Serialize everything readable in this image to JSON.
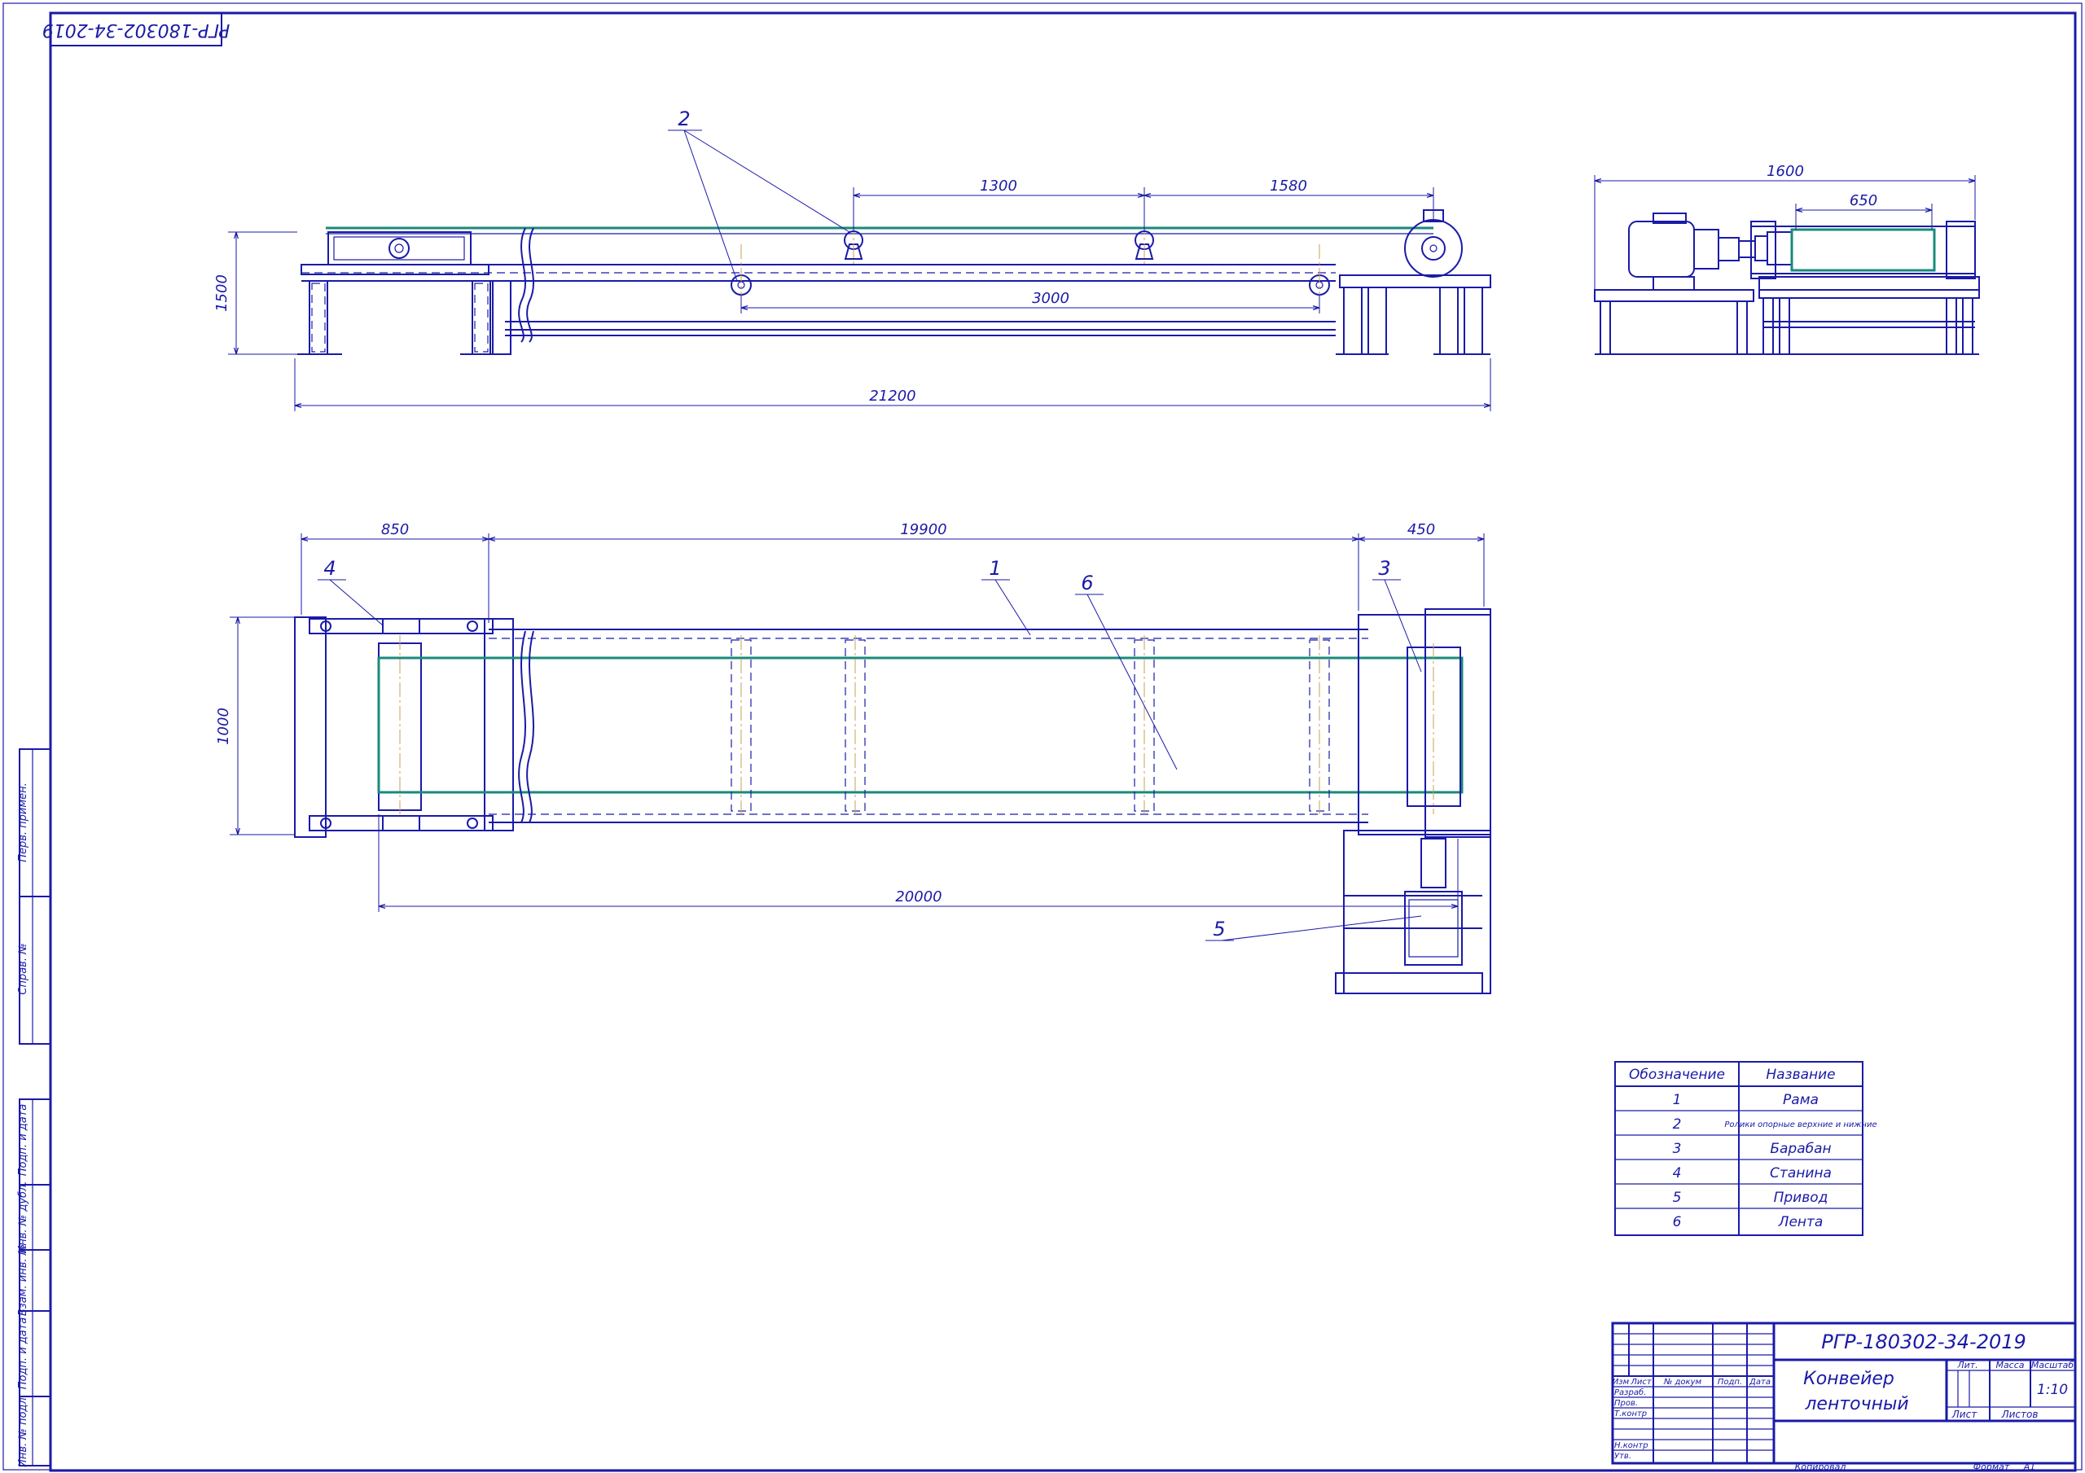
{
  "stamp": {
    "designation_rotated": "РГР-180302-34-2019"
  },
  "side_view": {
    "dimensions": {
      "d1300": "1300",
      "d1580": "1580",
      "d3000": "3000",
      "d21200": "21200",
      "d1500": "1500"
    },
    "callouts": {
      "c2": "2"
    }
  },
  "end_view": {
    "dimensions": {
      "d1600": "1600",
      "d650": "650"
    }
  },
  "plan_view": {
    "dimensions": {
      "d850": "850",
      "d19900": "19900",
      "d450": "450",
      "d1000": "1000",
      "d20000": "20000"
    },
    "callouts": {
      "c1": "1",
      "c3": "3",
      "c4": "4",
      "c5": "5",
      "c6": "6"
    }
  },
  "parts_table": {
    "headers": [
      "Обозначение",
      "Название"
    ],
    "rows": [
      [
        "1",
        "Рама"
      ],
      [
        "2",
        "Ролики опорные верхние и нижние"
      ],
      [
        "3",
        "Барабан"
      ],
      [
        "4",
        "Станина"
      ],
      [
        "5",
        "Привод"
      ],
      [
        "6",
        "Лента"
      ]
    ]
  },
  "title_block": {
    "designation": "РГР-180302-34-2019",
    "name_line1": "Конвейер",
    "name_line2": "ленточный",
    "col_izm": "Изм",
    "col_list": "Лист",
    "col_docnum": "№ докум",
    "col_podp": "Подп.",
    "col_data": "Дата",
    "row_razrab": "Разраб.",
    "row_prov": "Пров.",
    "row_tkontr": "Т.контр",
    "row_nkontr": "Н.контр",
    "row_utv": "Утв.",
    "lit": "Лит.",
    "massa": "Масса",
    "masshtab": "Масштаб",
    "scale_value": "1:10",
    "list": "Лист",
    "listov": "Листов",
    "kopiroval": "Копировал",
    "format_label": "Формат",
    "format_value": "А1"
  },
  "left_strip": {
    "perv_primen": "Перв. примен.",
    "sprav": "Справ. №",
    "podp_data_1": "Подп. и дата",
    "inv_dubl": "Инв. № дубл.",
    "vzam_inv": "Взам. инв. №",
    "podp_data_2": "Подп. и дата",
    "inv_podl": "Инв. № подл."
  },
  "colors": {
    "line": "#1a1aa8",
    "belt": "#1a8a7a",
    "centerline": "#c8a050"
  }
}
